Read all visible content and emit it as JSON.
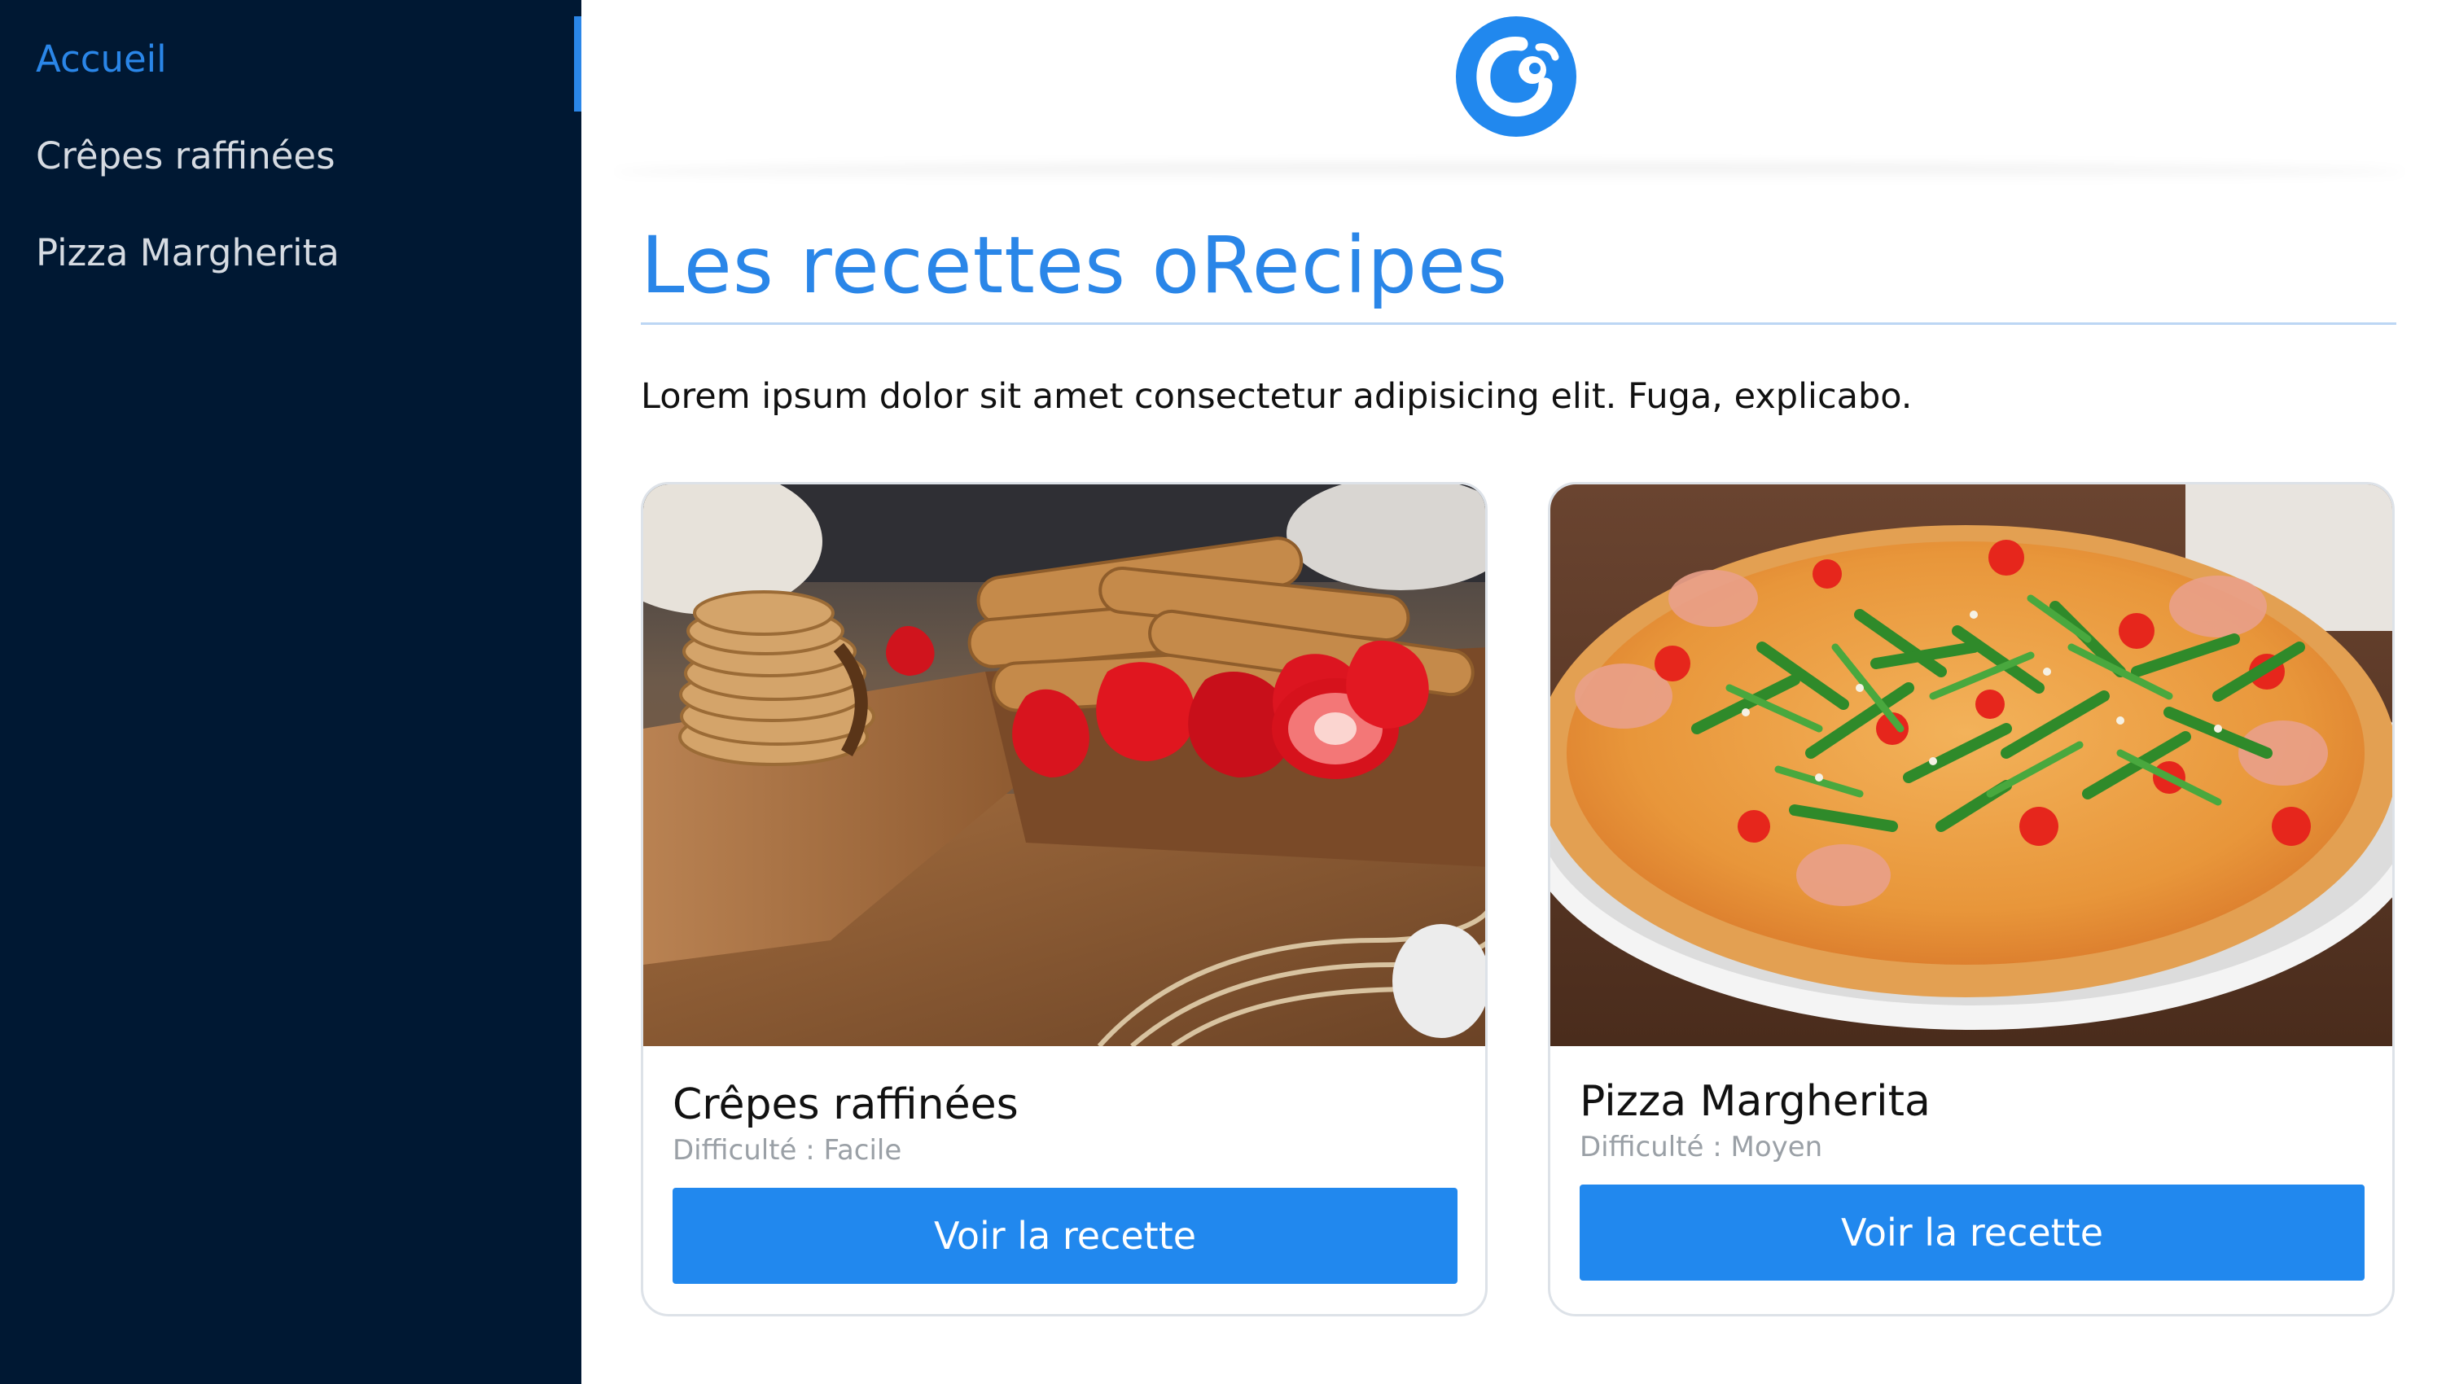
{
  "sidebar": {
    "items": [
      {
        "label": "Accueil",
        "active": true
      },
      {
        "label": "Crêpes raffinées",
        "active": false
      },
      {
        "label": "Pizza Margherita",
        "active": false
      }
    ]
  },
  "header": {
    "logo_icon": "orecipes-logo-icon"
  },
  "main": {
    "title": "Les recettes oRecipes",
    "intro": "Lorem ipsum dolor sit amet consectetur adipisicing elit. Fuga, explicabo.",
    "recipes": [
      {
        "title": "Crêpes raffinées",
        "difficulty": "Difficulté : Facile",
        "button_label": "Voir la recette",
        "image": "crepes-photo"
      },
      {
        "title": "Pizza Margherita",
        "difficulty": "Difficulté : Moyen",
        "button_label": "Voir la recette",
        "image": "pizza-photo"
      }
    ]
  },
  "colors": {
    "sidebar_bg": "#001833",
    "accent": "#2a86e8",
    "button": "#2188ee",
    "muted_text": "#9aa0a6"
  }
}
